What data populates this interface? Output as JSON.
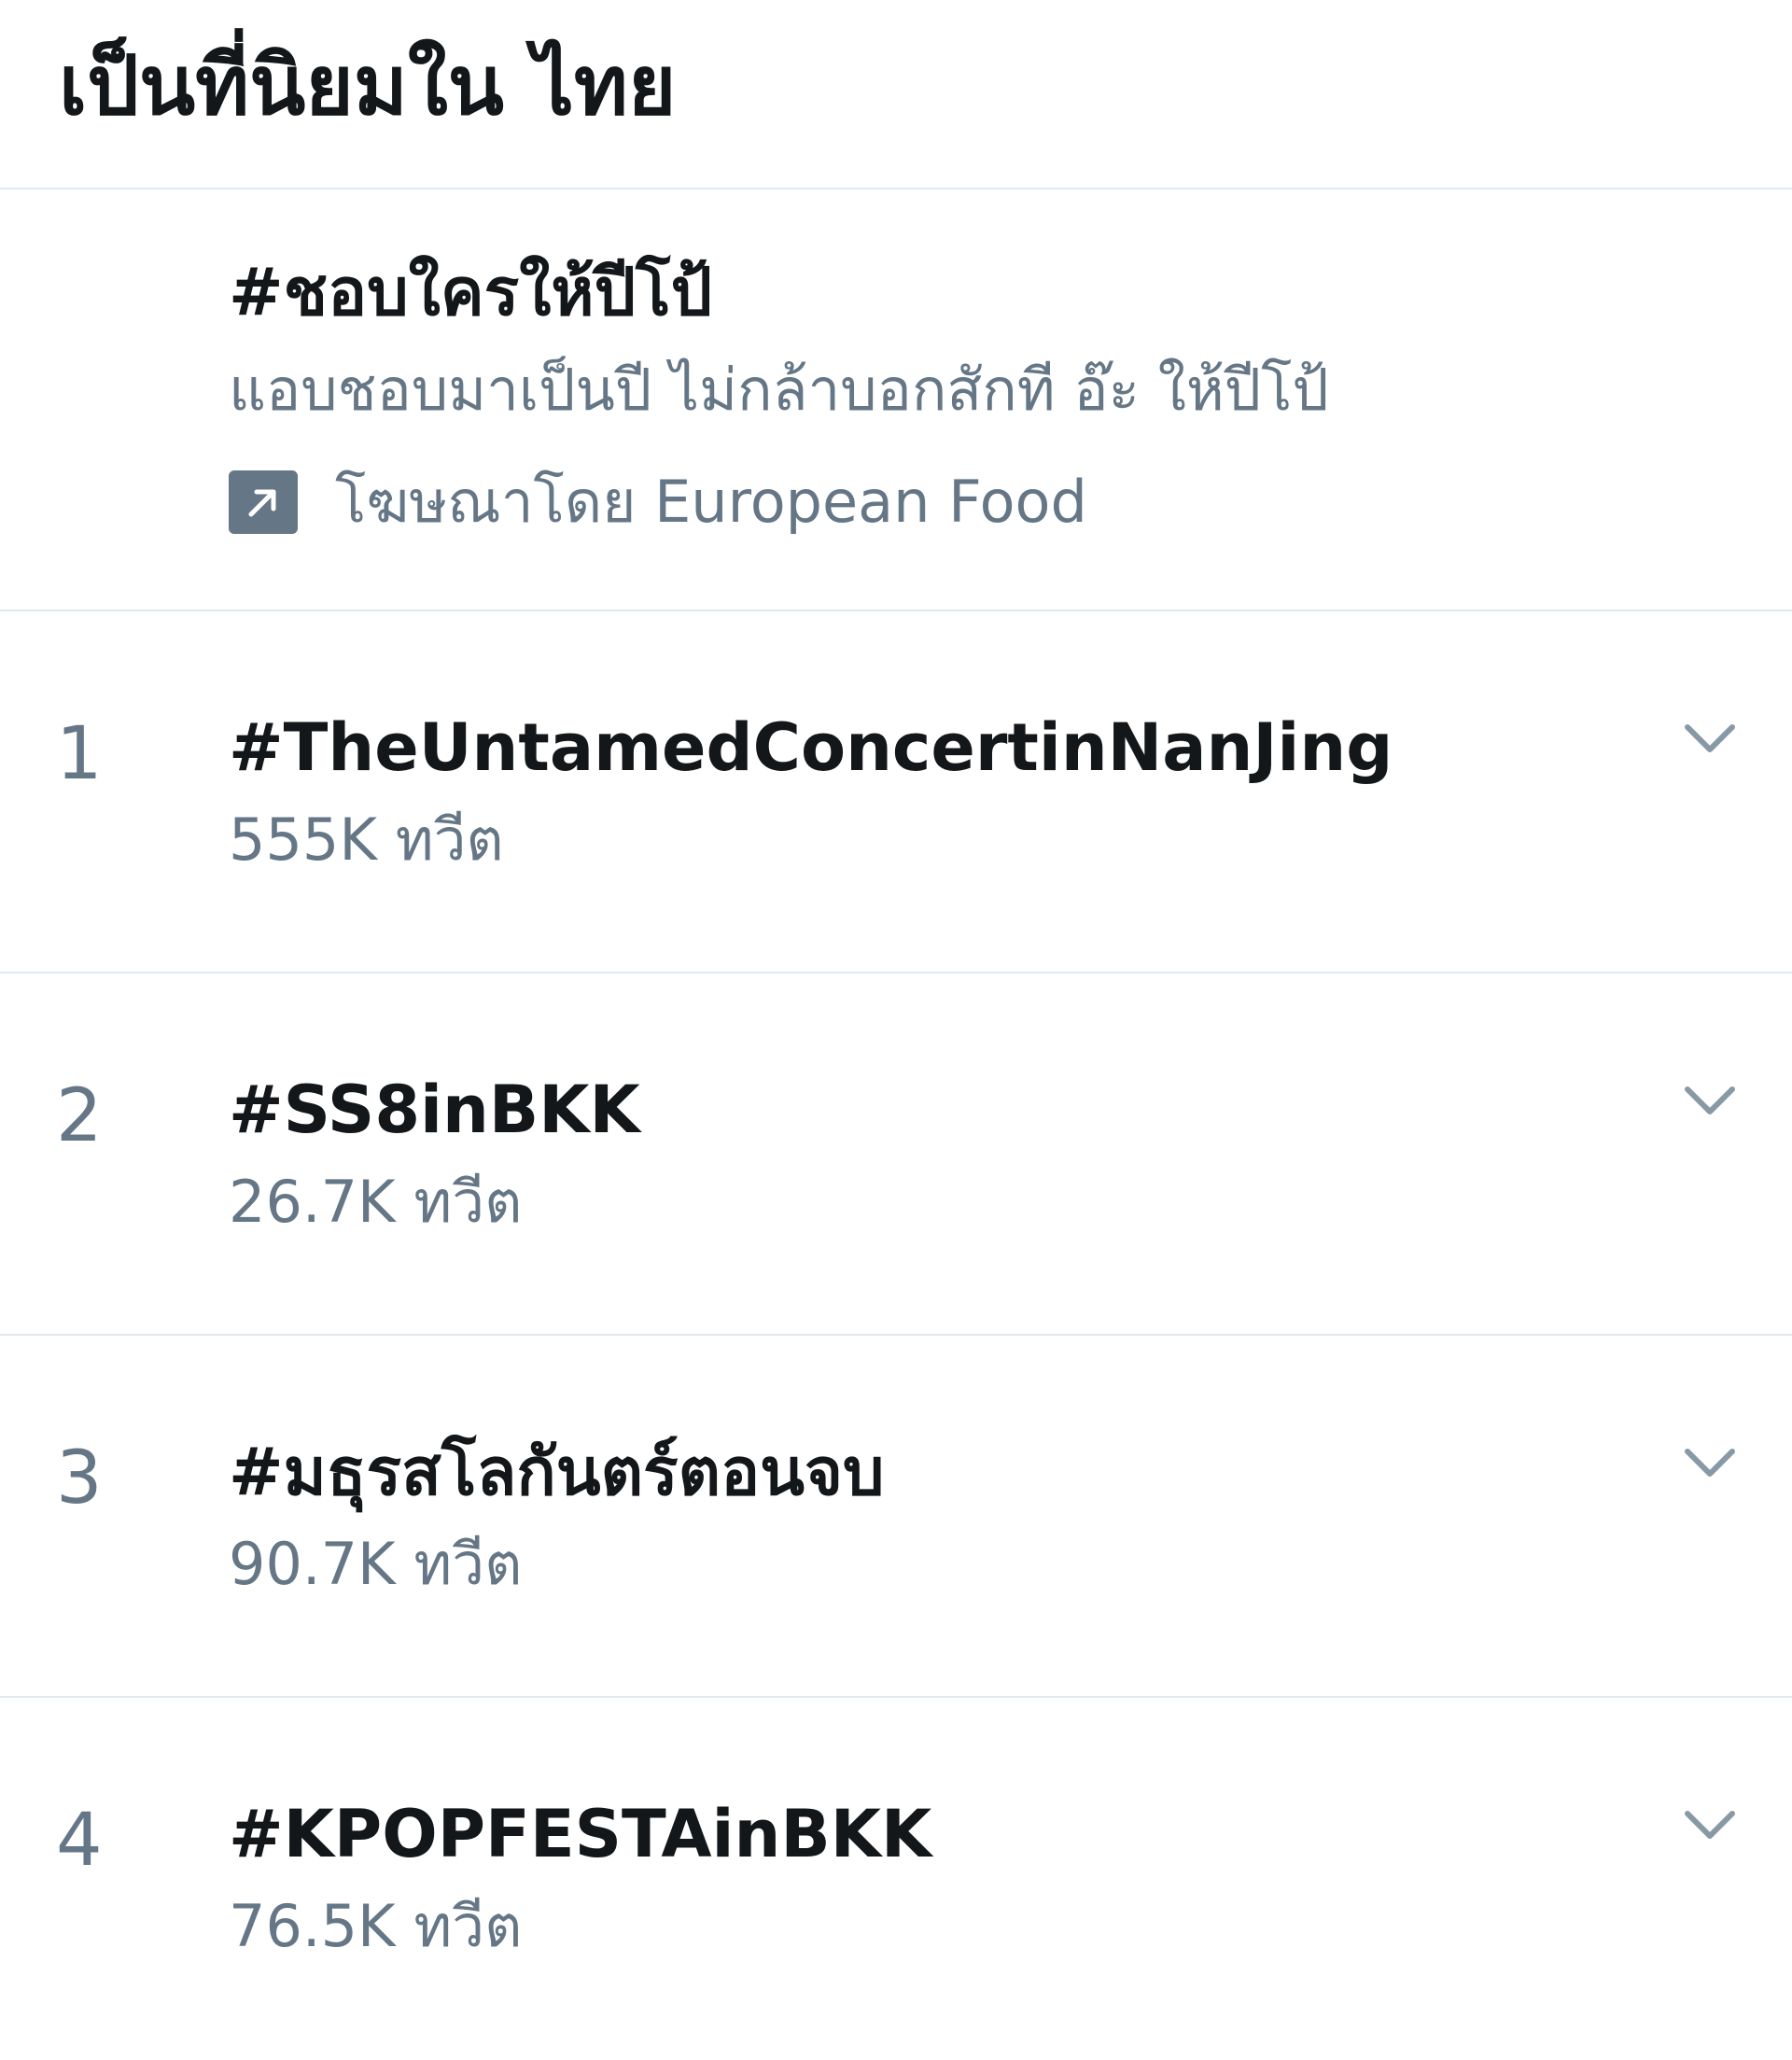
{
  "header": {
    "title": "เป็นที่นิยมใน ไทย"
  },
  "promoted": {
    "title": "#ชอบใครให้ปีโป้",
    "description": "แอบชอบมาเป็นปี ไม่กล้าบอกสักที อ๊ะ ให้ปีโป้",
    "promoted_by": "โฆษณาโดย European Food",
    "icon": "promoted-arrow-icon"
  },
  "trends": [
    {
      "rank": "1",
      "name": "#TheUntamedConcertinNanJing",
      "count": "555K ทวีต"
    },
    {
      "rank": "2",
      "name": "#SS8inBKK",
      "count": "26.7K ทวีต"
    },
    {
      "rank": "3",
      "name": "#มธุรสโลกันตร์ตอนจบ",
      "count": "90.7K ทวีต"
    },
    {
      "rank": "4",
      "name": "#KPOPFESTAinBKK",
      "count": "76.5K ทวีต"
    }
  ],
  "colors": {
    "primary_text": "#14171a",
    "secondary_text": "#657786",
    "divider": "#e1e8ed",
    "caret": "#8899a6"
  }
}
